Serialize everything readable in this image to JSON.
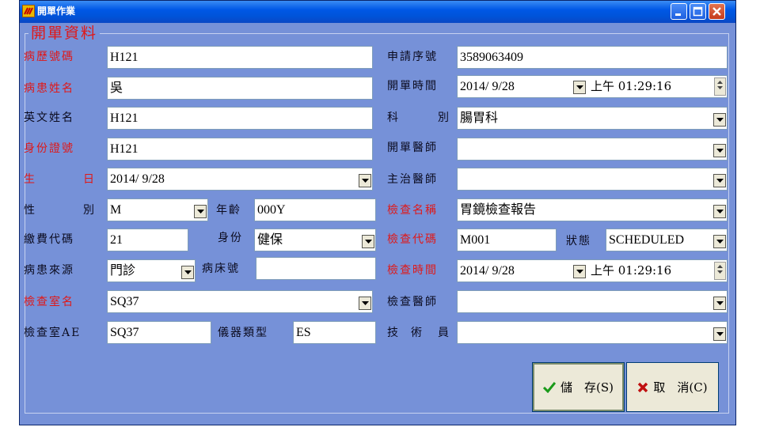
{
  "window": {
    "title": "開單作業",
    "group_title": "開單資料"
  },
  "left": {
    "chart_no": {
      "label": "病歷號碼",
      "value": "H121"
    },
    "patient_name": {
      "label": "病患姓名",
      "value": "吳"
    },
    "english_name": {
      "label": "英文姓名",
      "value": "H121"
    },
    "id_number": {
      "label": "身份證號",
      "value": "H121"
    },
    "birthday": {
      "label_a": "生",
      "label_b": "日",
      "value": "2014/ 9/28"
    },
    "sex": {
      "label_a": "性",
      "label_b": "別",
      "value": "M"
    },
    "age": {
      "label": "年齡",
      "value": "000Y"
    },
    "payment_code": {
      "label": "繳費代碼",
      "value": "21"
    },
    "identity": {
      "label": "身份",
      "value": "健保"
    },
    "patient_source": {
      "label": "病患來源",
      "value": "門診"
    },
    "bed_no": {
      "label": "病床號",
      "value": ""
    },
    "exam_room": {
      "label": "檢查室名",
      "value": "SQ37"
    },
    "exam_room_ae": {
      "label": "檢查室AE",
      "value": "SQ37"
    },
    "device_type": {
      "label": "儀器類型",
      "value": "ES"
    }
  },
  "right": {
    "request_no": {
      "label": "申請序號",
      "value": "3589063409"
    },
    "order_time": {
      "label": "開單時間",
      "date": "2014/ 9/28",
      "time": "上午 01:29:16"
    },
    "department": {
      "label_a": "科",
      "label_b": "別",
      "value": "腸胃科"
    },
    "ordering_doctor": {
      "label": "開單醫師",
      "value": ""
    },
    "attending_doctor": {
      "label": "主治醫師",
      "value": ""
    },
    "exam_name": {
      "label": "檢查名稱",
      "value": "胃鏡檢查報告"
    },
    "exam_code": {
      "label": "檢查代碼",
      "value": "M001"
    },
    "status": {
      "label": "狀態",
      "value": "SCHEDULED"
    },
    "exam_time": {
      "label": "檢查時間",
      "date": "2014/ 9/28",
      "time": "上午 01:29:16"
    },
    "exam_doctor": {
      "label": "檢查醫師",
      "value": ""
    },
    "technician": {
      "label_a": "技",
      "label_b": "術",
      "label_c": "員",
      "value": ""
    }
  },
  "buttons": {
    "save": "儲　存(S)",
    "cancel": "取　消(C)"
  },
  "icons": {
    "app": "app-logo-icon",
    "save": "checkmark-icon",
    "cancel": "x-mark-icon"
  },
  "colors": {
    "form_background": "#7691d8",
    "required_label": "#e01818",
    "normal_label": "#0b0b1f",
    "title_bar": "#0058e6",
    "save_check": "#1a9a1a",
    "cancel_x": "#c01010"
  }
}
